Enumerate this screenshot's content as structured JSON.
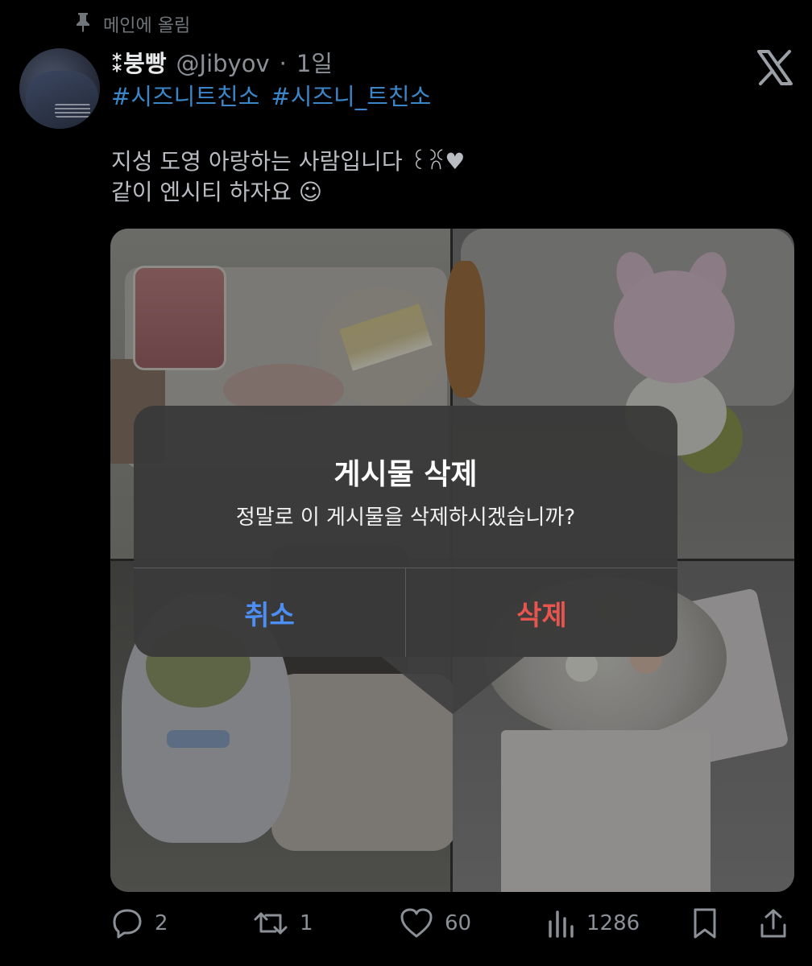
{
  "pinned": {
    "label": "메인에 올림"
  },
  "tweet": {
    "display_name": "⁑붕빵",
    "handle": "@Jibyov",
    "separator": "·",
    "time": "1일",
    "hashtags": [
      "#시즈니트친소",
      "#시즈니_트친소"
    ],
    "body_lines": [
      "지성 도영 아랑하는 사람입니다 ꒰ꐦ♥",
      "같이 엔시티 하자요 ☺"
    ]
  },
  "dialog": {
    "title": "게시물 삭제",
    "message": "정말로 이 게시물을 삭제하시겠습니까?",
    "cancel_label": "취소",
    "delete_label": "삭제"
  },
  "actions": {
    "replies": "2",
    "retweets": "1",
    "likes": "60",
    "views": "1286"
  },
  "icons": {
    "pin": "pin-icon",
    "logo": "x-logo-icon",
    "reply": "reply-icon",
    "retweet": "retweet-icon",
    "like": "heart-icon",
    "views": "views-icon",
    "bookmark": "bookmark-icon",
    "share": "share-icon"
  },
  "colors": {
    "background": "#000000",
    "hashtag": "#3a86c8",
    "cancel_button": "#4c8ef3",
    "delete_button": "#e8544e",
    "dialog_bg": "#3a3a3a",
    "muted_text": "#8b9096"
  }
}
